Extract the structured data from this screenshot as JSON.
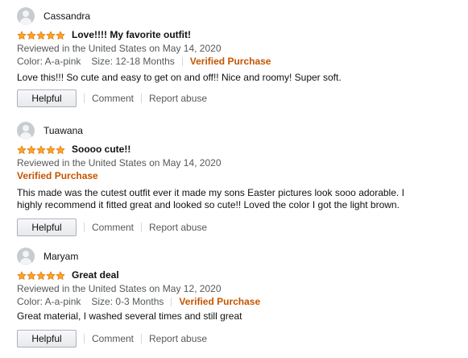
{
  "reviews": [
    {
      "reviewer": "Cassandra",
      "rating": 5,
      "title": "Love!!!! My favorite outfit!",
      "date": "Reviewed in the United States on May 14, 2020",
      "color": "Color: A-a-pink",
      "size": "Size: 12-18 Months",
      "verified": "Verified Purchase",
      "body": "Love this!!! So cute and easy to get on and off!! Nice and roomy! Super soft.",
      "helpful": "Helpful",
      "comment": "Comment",
      "report": "Report abuse"
    },
    {
      "reviewer": "Tuawana",
      "rating": 5,
      "title": "Soooo cute!!",
      "date": "Reviewed in the United States on May 14, 2020",
      "verified": "Verified Purchase",
      "body_line1": "This made was the cutest outfit ever it made my sons Easter pictures look sooo adorable. I",
      "body_line2": "highly recommend it fitted great and looked so cute!! Loved the color I got the light brown.",
      "helpful": "Helpful",
      "comment": "Comment",
      "report": "Report abuse"
    },
    {
      "reviewer": "Maryam",
      "rating": 5,
      "title": "Great deal",
      "date": "Reviewed in the United States on May 12, 2020",
      "color": "Color: A-a-pink",
      "size": "Size: 0-3 Months",
      "verified": "Verified Purchase",
      "body": "Great material, I washed several times and still great",
      "helpful": "Helpful",
      "comment": "Comment",
      "report": "Report abuse"
    }
  ],
  "colors": {
    "star": "#ffa41c",
    "verified": "#c45500",
    "meta": "#565959",
    "avatar": "#c8ccd1"
  },
  "icons": {
    "avatar": "user-avatar-icon",
    "star": "star-icon"
  }
}
